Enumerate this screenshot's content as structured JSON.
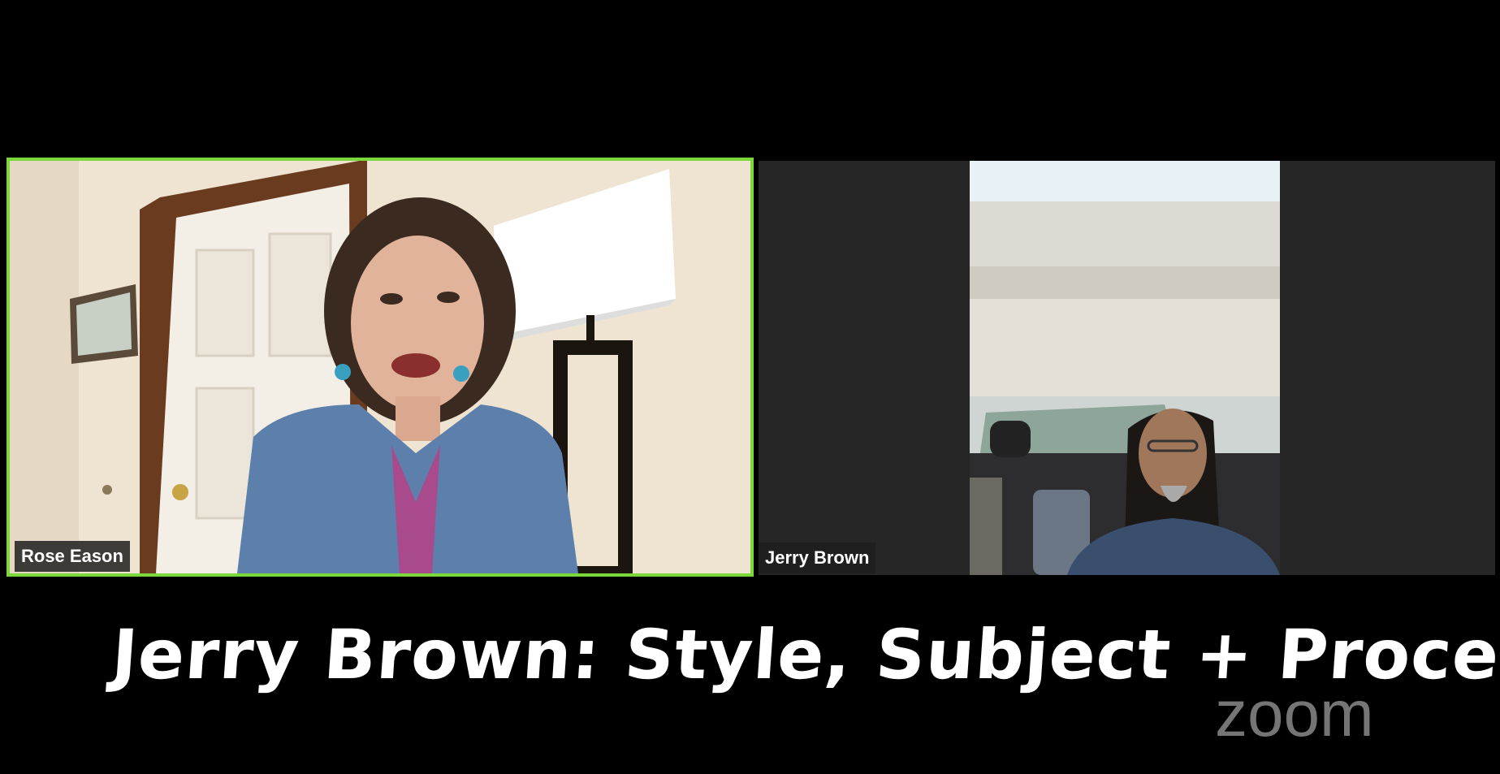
{
  "participants": [
    {
      "name": "Rose Eason",
      "active_speaker": true
    },
    {
      "name": "Jerry Brown",
      "active_speaker": false
    }
  ],
  "caption": "Jerry Brown: Style, Subject + Process",
  "watermark": "zoom",
  "colors": {
    "active_speaker_border": "#7ad83a",
    "background": "#000000",
    "tile_background": "#262626"
  }
}
